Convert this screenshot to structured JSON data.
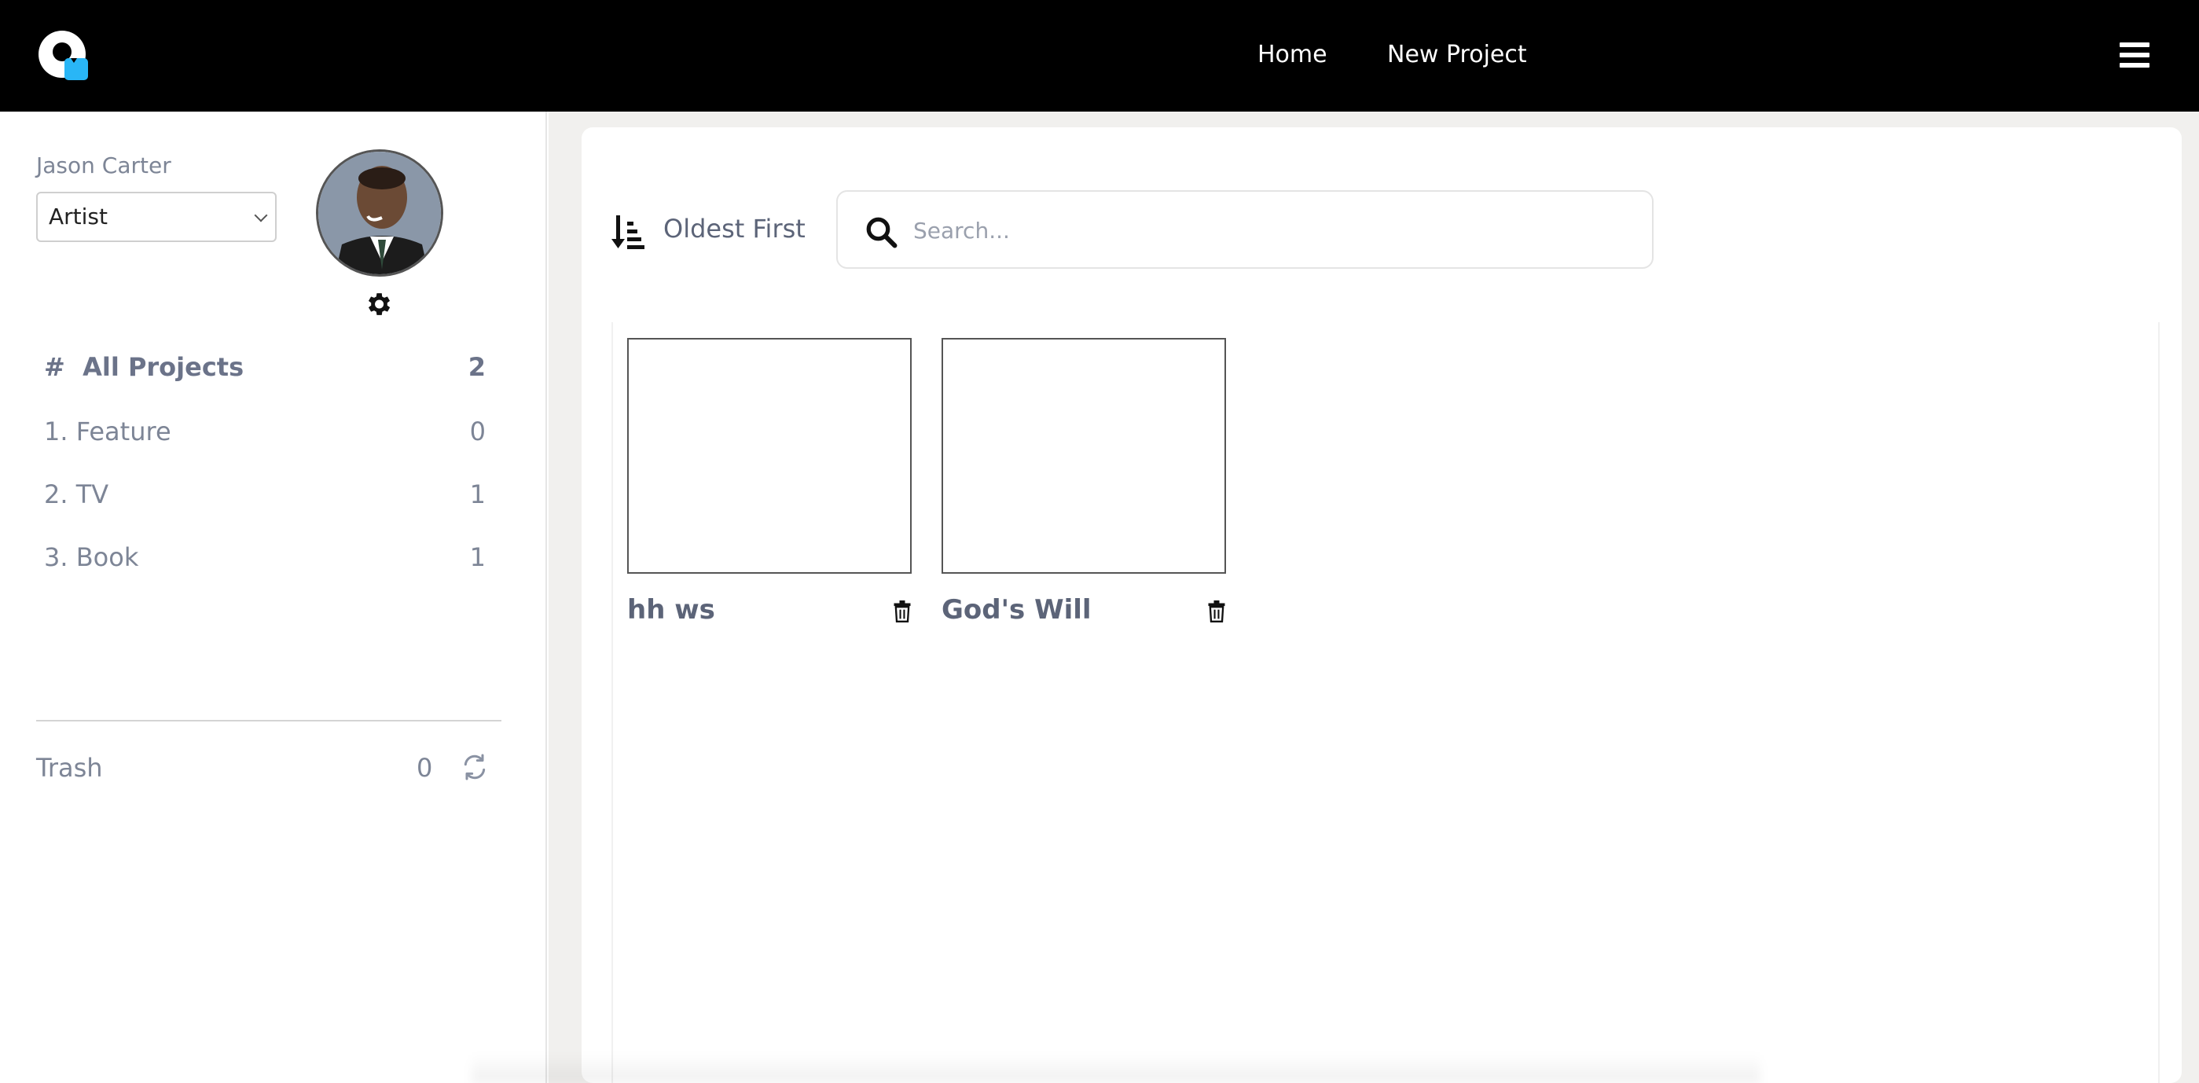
{
  "nav": {
    "logo": "app-logo-icon",
    "links": [
      "Home",
      "New Project"
    ],
    "menu_icon": "hamburger-icon"
  },
  "sidebar": {
    "user_name": "Jason Carter",
    "role": "Artist",
    "categories": [
      {
        "label": "All Projects",
        "prefix": "#",
        "count": "2"
      },
      {
        "label": "1. Feature",
        "count": "0"
      },
      {
        "label": "2. TV",
        "count": "1"
      },
      {
        "label": "3. Book",
        "count": "1"
      }
    ],
    "trash": {
      "label": "Trash",
      "count": "0"
    }
  },
  "toolbar": {
    "sort_label": "Oldest First",
    "search_placeholder": "Search..."
  },
  "projects": [
    {
      "title": "hh ws"
    },
    {
      "title": "God's Will"
    }
  ],
  "colors": {
    "topbar": "#000000",
    "accent": "#29b6f6",
    "text": "#6b7389",
    "main_bg": "#f1f0ee"
  }
}
